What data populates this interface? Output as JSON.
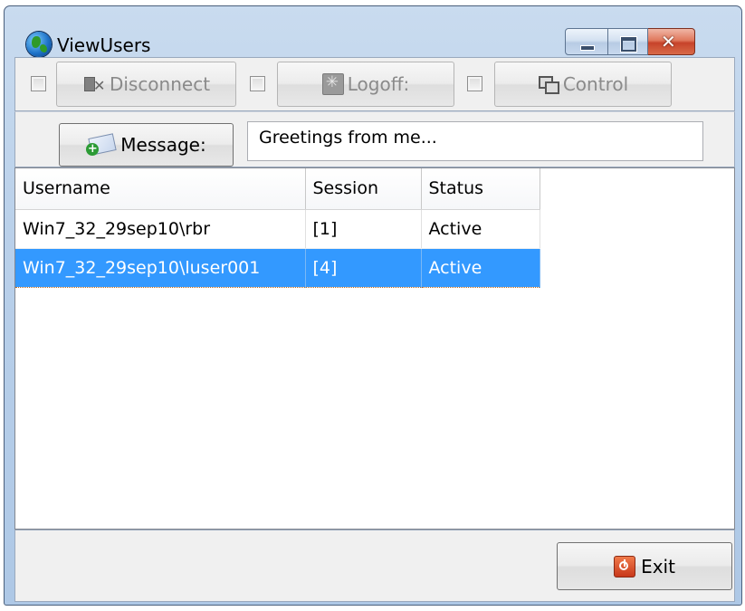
{
  "window": {
    "title": "ViewUsers",
    "close_glyph": "✕"
  },
  "toolbar": {
    "disconnect_label": "Disconnect",
    "logoff_label": "Logoff:",
    "control_label": "Control",
    "message_label": "Message:",
    "message_text": "Greetings from me..."
  },
  "table": {
    "columns": [
      "Username",
      "Session",
      "Status"
    ],
    "rows": [
      {
        "username": "Win7_32_29sep10\\rbr",
        "session": "[1]",
        "status": "Active"
      },
      {
        "username": "Win7_32_29sep10\\luser001",
        "session": "[4]",
        "status": "Active"
      }
    ],
    "selected_row": 1
  },
  "footer": {
    "exit_label": "Exit"
  },
  "colors": {
    "selection": "#3399ff",
    "window_frame": "#b9d0ea",
    "close_button": "#c7432a"
  }
}
